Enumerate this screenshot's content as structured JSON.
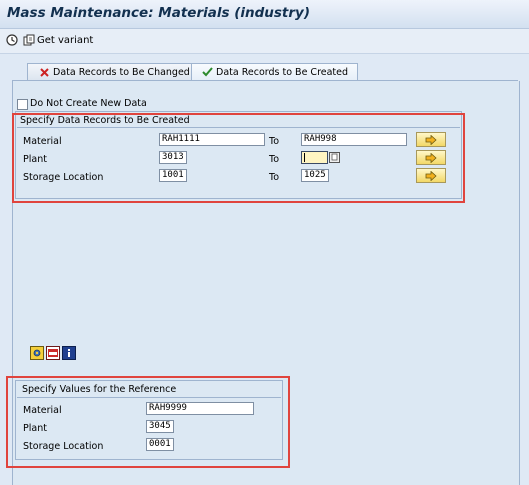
{
  "title": "Mass Maintenance: Materials (industry)",
  "toolbar": {
    "get_variant_label": "Get variant"
  },
  "tabs": [
    {
      "label": "Data Records to Be Changed",
      "icon": "red-x-icon"
    },
    {
      "label": "Data Records to Be Created",
      "icon": "green-check-icon",
      "active": true
    }
  ],
  "do_not_create": {
    "label": "Do Not Create New Data",
    "checked": false
  },
  "create_group": {
    "title": "Specify Data Records to Be Created",
    "rows": [
      {
        "label": "Material",
        "from": "RAH1111",
        "to_label": "To",
        "to": "RAH998"
      },
      {
        "label": "Plant",
        "from": "3013",
        "to_label": "To",
        "to": ""
      },
      {
        "label": "Storage Location",
        "from": "1001",
        "to_label": "To",
        "to": "1025"
      }
    ]
  },
  "reference_group": {
    "title": "Specify Values for the Reference",
    "rows": [
      {
        "label": "Material",
        "value": "RAH9999"
      },
      {
        "label": "Plant",
        "value": "3045"
      },
      {
        "label": "Storage Location",
        "value": "0001"
      }
    ]
  },
  "colors": {
    "highlight": "#e0443d",
    "panel_bg": "#dce8f3",
    "title_text": "#12304f"
  }
}
